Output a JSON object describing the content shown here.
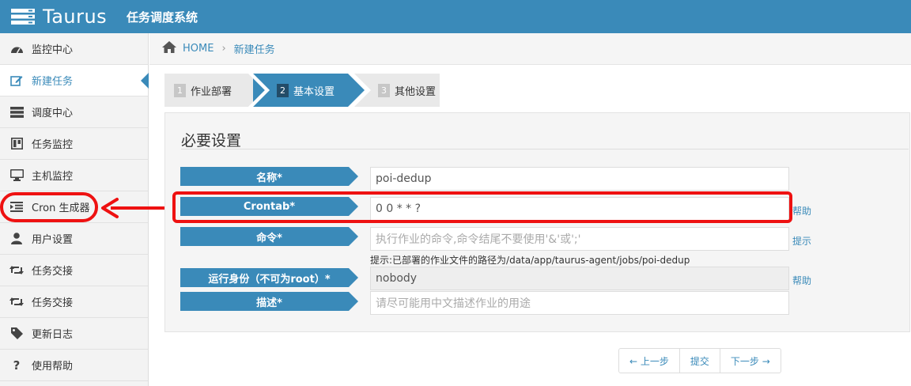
{
  "header": {
    "logo_text": "Taurus",
    "system_name": "任务调度系统"
  },
  "sidebar": {
    "items": [
      {
        "label": "监控中心",
        "icon": "dashboard-icon"
      },
      {
        "label": "新建任务",
        "icon": "edit-icon",
        "active": true
      },
      {
        "label": "调度中心",
        "icon": "server-icon"
      },
      {
        "label": "任务监控",
        "icon": "board-icon"
      },
      {
        "label": "主机监控",
        "icon": "monitor-icon"
      },
      {
        "label": "Cron 生成器",
        "icon": "indent-icon"
      },
      {
        "label": "用户设置",
        "icon": "user-icon"
      },
      {
        "label": "任务交接",
        "icon": "retweet-icon"
      },
      {
        "label": "任务交接",
        "icon": "retweet-icon"
      },
      {
        "label": "更新日志",
        "icon": "tag-icon"
      },
      {
        "label": "使用帮助",
        "icon": "question-icon"
      }
    ]
  },
  "breadcrumb": {
    "home": "HOME",
    "current": "新建任务"
  },
  "steps": [
    {
      "num": "1",
      "label": "作业部署"
    },
    {
      "num": "2",
      "label": "基本设置"
    },
    {
      "num": "3",
      "label": "其他设置"
    }
  ],
  "form": {
    "title": "必要设置",
    "name_label": "名称*",
    "name_value": "poi-dedup",
    "crontab_label": "Crontab*",
    "crontab_value": "0 0 * * ?",
    "crontab_help": "帮助",
    "command_label": "命令*",
    "command_placeholder": "执行作业的命令,命令结尾不要使用'&'或';'",
    "command_help": "提示",
    "deploy_hint": "提示:已部署的作业文件的路径为/data/app/taurus-agent/jobs/poi-dedup",
    "runas_label": "运行身份（不可为root）*",
    "runas_value": "nobody",
    "runas_help": "帮助",
    "desc_label": "描述*",
    "desc_placeholder": "请尽可能用中文描述作业的用途"
  },
  "pager": {
    "prev": "← 上一步",
    "submit": "提交",
    "next": "下一步 →"
  },
  "colors": {
    "primary": "#3a8ab9",
    "annotation": "#e11111"
  }
}
